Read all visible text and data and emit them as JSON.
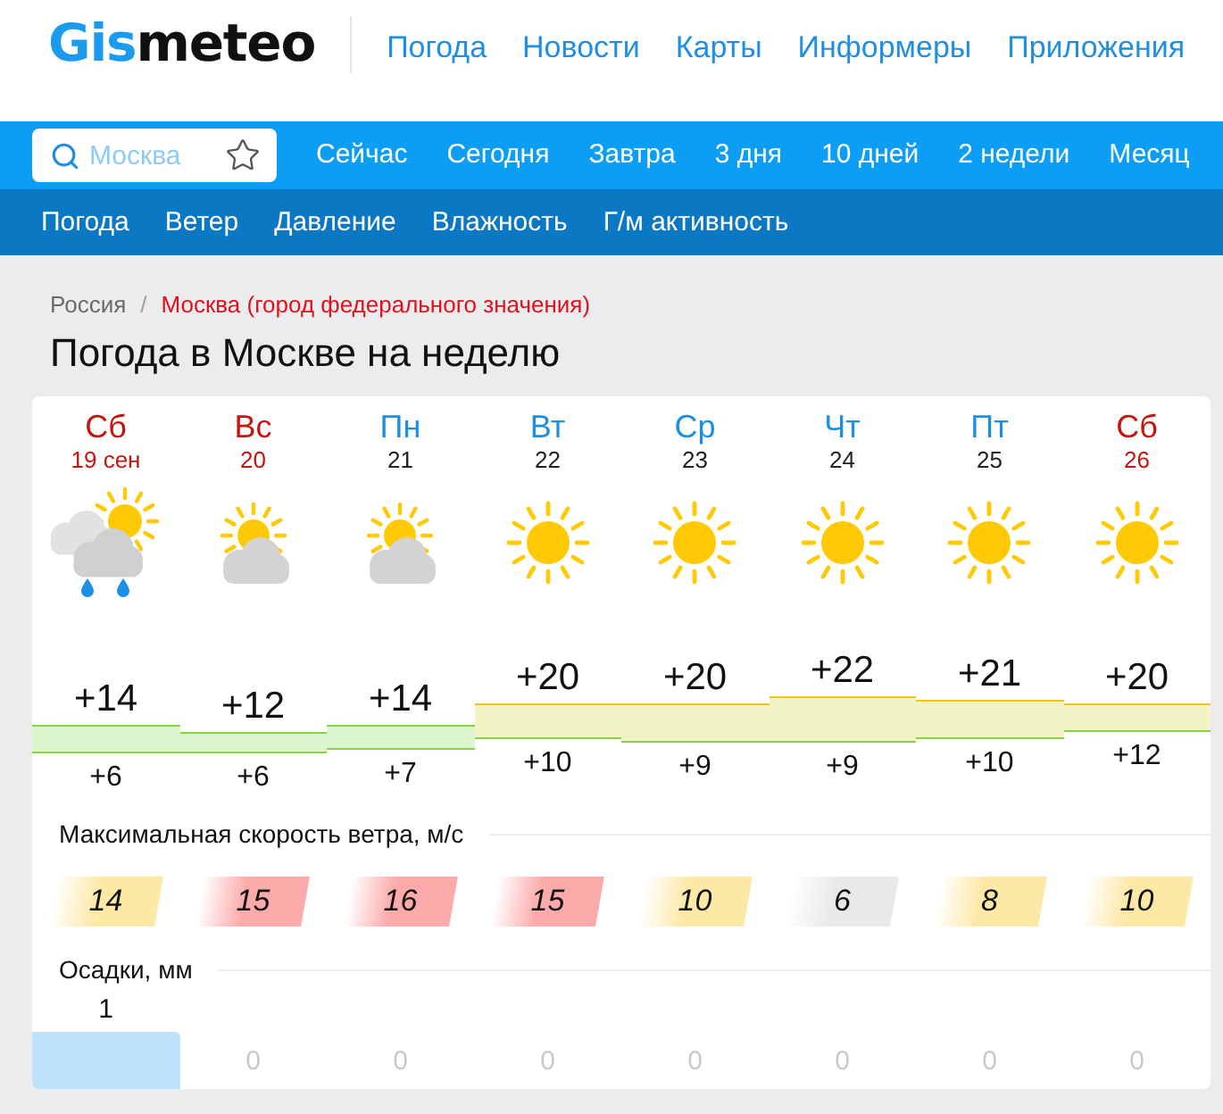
{
  "header": {
    "logo": {
      "accent": "Gis",
      "rest": "meteo"
    },
    "nav": [
      "Погода",
      "Новости",
      "Карты",
      "Информеры",
      "Приложения"
    ]
  },
  "search": {
    "placeholder": "Москва"
  },
  "period_tabs": [
    {
      "label": "Сейчас",
      "selected": false
    },
    {
      "label": "Сегодня",
      "selected": false
    },
    {
      "label": "Завтра",
      "selected": false
    },
    {
      "label": "3 дня",
      "selected": false
    },
    {
      "label": "10 дней",
      "selected": false
    },
    {
      "label": "2 недели",
      "selected": false
    },
    {
      "label": "Месяц",
      "selected": false
    }
  ],
  "section_tabs": [
    {
      "label": "Погода",
      "selected": false
    },
    {
      "label": "Ветер",
      "selected": false
    },
    {
      "label": "Давление",
      "selected": false
    },
    {
      "label": "Влажность",
      "selected": false
    },
    {
      "label": "Г/м активность",
      "selected": false
    }
  ],
  "breadcrumb": {
    "separator": "/",
    "items": [
      {
        "label": "Россия",
        "current": false
      },
      {
        "label": "Москва (город федерального значения)",
        "current": true
      }
    ]
  },
  "title": "Погода в Москве на неделю",
  "forecast": {
    "days": [
      {
        "name": "Сб",
        "date": "19 сен",
        "weekend": true,
        "kind": "rain"
      },
      {
        "name": "Вс",
        "date": "20",
        "weekend": true,
        "kind": "cloudy"
      },
      {
        "name": "Пн",
        "date": "21",
        "weekend": false,
        "kind": "cloudy"
      },
      {
        "name": "Вт",
        "date": "22",
        "weekend": false,
        "kind": "clear"
      },
      {
        "name": "Ср",
        "date": "23",
        "weekend": false,
        "kind": "clear"
      },
      {
        "name": "Чт",
        "date": "24",
        "weekend": false,
        "kind": "clear"
      },
      {
        "name": "Пт",
        "date": "25",
        "weekend": false,
        "kind": "clear"
      },
      {
        "name": "Сб",
        "date": "26",
        "weekend": true,
        "kind": "clear"
      }
    ],
    "temperatures": [
      {
        "max": "+14",
        "min": "+6"
      },
      {
        "max": "+12",
        "min": "+6"
      },
      {
        "max": "+14",
        "min": "+7"
      },
      {
        "max": "+20",
        "min": "+10"
      },
      {
        "max": "+20",
        "min": "+9"
      },
      {
        "max": "+22",
        "min": "+9"
      },
      {
        "max": "+21",
        "min": "+10"
      },
      {
        "max": "+20",
        "min": "+12"
      }
    ],
    "wind": {
      "title": "Максимальная скорость ветра, м/с",
      "values": [
        {
          "speed": "14",
          "color": "#fee8a6"
        },
        {
          "speed": "15",
          "color": "#fdaaaa"
        },
        {
          "speed": "16",
          "color": "#fdaaaa"
        },
        {
          "speed": "15",
          "color": "#fdaaaa"
        },
        {
          "speed": "10",
          "color": "#fee8a6"
        },
        {
          "speed": "6",
          "color": "#e9e9eb"
        },
        {
          "speed": "8",
          "color": "#fee8a6"
        },
        {
          "speed": "10",
          "color": "#fee8a6"
        }
      ]
    },
    "precipitation": {
      "title": "Осадки, мм",
      "values": [
        "1",
        "0",
        "0",
        "0",
        "0",
        "0",
        "0",
        "0"
      ]
    }
  }
}
